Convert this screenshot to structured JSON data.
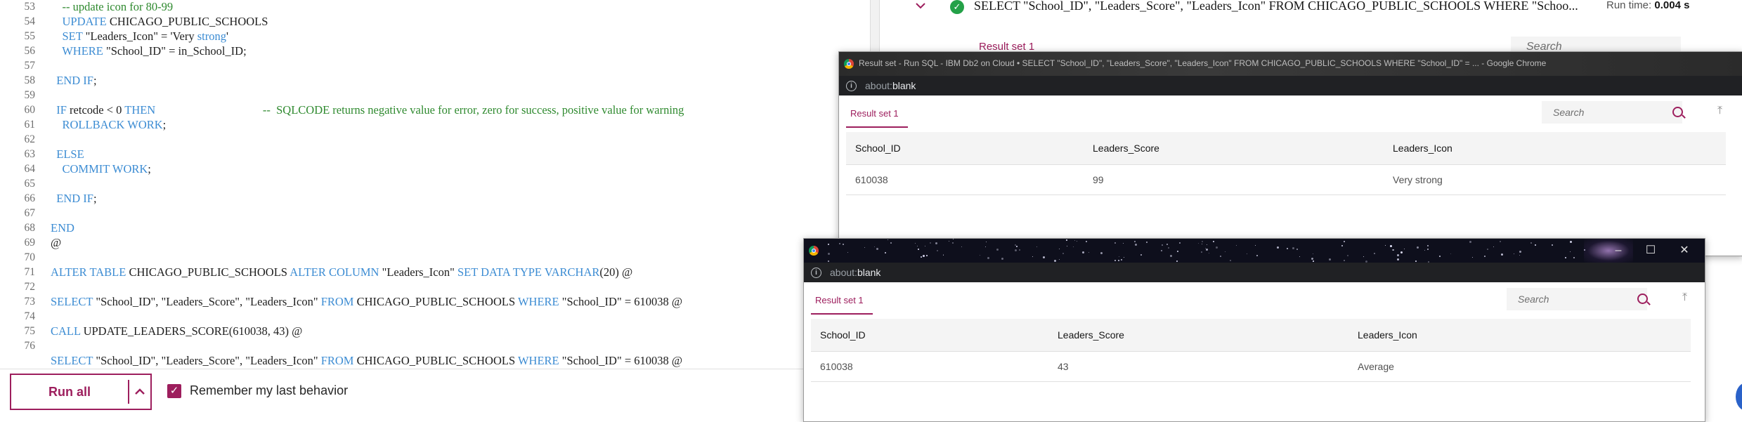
{
  "editor": {
    "lines": [
      {
        "n": "53",
        "html": "    <span class=\"cm\">-- update icon for 80-99</span>"
      },
      {
        "n": "54",
        "html": "    <span class=\"kw\">UPDATE</span> CHICAGO_PUBLIC_SCHOOLS"
      },
      {
        "n": "55",
        "html": "    <span class=\"kw\">SET</span> \"Leaders_Icon\" = 'Very <span class=\"kw\">strong</span>'"
      },
      {
        "n": "56",
        "html": "    <span class=\"kw\">WHERE</span> \"School_ID\" = in_School_ID;"
      },
      {
        "n": "57",
        "html": ""
      },
      {
        "n": "58",
        "html": "  <span class=\"kw\">END IF</span>;"
      },
      {
        "n": "59",
        "html": ""
      },
      {
        "n": "60",
        "html": "  <span class=\"kw\">IF</span> retcode &lt; 0 <span class=\"kw\">THEN</span>                                     <span class=\"cm\">--  SQLCODE returns negative value for error, zero for success, positive value for warning</span>"
      },
      {
        "n": "61",
        "html": "    <span class=\"kw\">ROLLBACK WORK</span>;"
      },
      {
        "n": "62",
        "html": ""
      },
      {
        "n": "63",
        "html": "  <span class=\"kw\">ELSE</span>"
      },
      {
        "n": "64",
        "html": "    <span class=\"kw\">COMMIT WORK</span>;"
      },
      {
        "n": "65",
        "html": ""
      },
      {
        "n": "66",
        "html": "  <span class=\"kw\">END IF</span>;"
      },
      {
        "n": "67",
        "html": ""
      },
      {
        "n": "68",
        "html": "<span class=\"kw\">END</span>"
      },
      {
        "n": "69",
        "html": "@"
      },
      {
        "n": "70",
        "html": ""
      },
      {
        "n": "71",
        "html": "<span class=\"kw\">ALTER TABLE</span> CHICAGO_PUBLIC_SCHOOLS <span class=\"kw\">ALTER COLUMN</span> \"Leaders_Icon\" <span class=\"kw\">SET DATA TYPE VARCHAR</span>(20) @"
      },
      {
        "n": "72",
        "html": ""
      },
      {
        "n": "73",
        "html": "<span class=\"kw\">SELECT</span> \"School_ID\", \"Leaders_Score\", \"Leaders_Icon\" <span class=\"kw\">FROM</span> CHICAGO_PUBLIC_SCHOOLS <span class=\"kw\">WHERE</span> \"School_ID\" = 610038 @"
      },
      {
        "n": "74",
        "html": ""
      },
      {
        "n": "75",
        "html": "<span class=\"kw\">CALL</span> UPDATE_LEADERS_SCORE(610038, 43) @"
      },
      {
        "n": "76",
        "html": ""
      },
      {
        "n": "",
        "html": "<span class=\"kw\">SELECT</span> \"School_ID\", \"Leaders_Score\", \"Leaders_Icon\" <span class=\"kw\">FROM</span> CHICAGO_PUBLIC_SCHOOLS <span class=\"kw\">WHERE</span> \"School_ID\" = 610038 @"
      }
    ]
  },
  "bottombar": {
    "run_all_label": "Run all",
    "remember_label": "Remember my last behavior"
  },
  "background_panel": {
    "query": "SELECT \"School_ID\", \"Leaders_Score\", \"Leaders_Icon\" FROM CHICAGO_PUBLIC_SCHOOLS WHERE \"Schoo...",
    "runtime_label": "Run time:",
    "runtime_value": "0.004 s",
    "tab_label": "Result set 1",
    "search_placeholder": "Search"
  },
  "popup1": {
    "title": "Result set - Run SQL - IBM Db2 on Cloud • SELECT \"School_ID\", \"Leaders_Score\", \"Leaders_Icon\" FROM CHICAGO_PUBLIC_SCHOOLS WHERE \"School_ID\" = ... - Google Chrome",
    "address_prefix": "about:",
    "address_main": "blank",
    "tab_label": "Result set 1",
    "search_placeholder": "Search",
    "columns": [
      "School_ID",
      "Leaders_Score",
      "Leaders_Icon"
    ],
    "rows": [
      [
        "610038",
        "99",
        "Very strong"
      ]
    ]
  },
  "popup2": {
    "address_prefix": "about:",
    "address_main": "blank",
    "tab_label": "Result set 1",
    "search_placeholder": "Search",
    "window_controls": {
      "minimize": "–",
      "maximize": "☐",
      "close": "✕"
    },
    "columns": [
      "School_ID",
      "Leaders_Score",
      "Leaders_Icon"
    ],
    "rows": [
      [
        "610038",
        "43",
        "Average"
      ]
    ]
  }
}
